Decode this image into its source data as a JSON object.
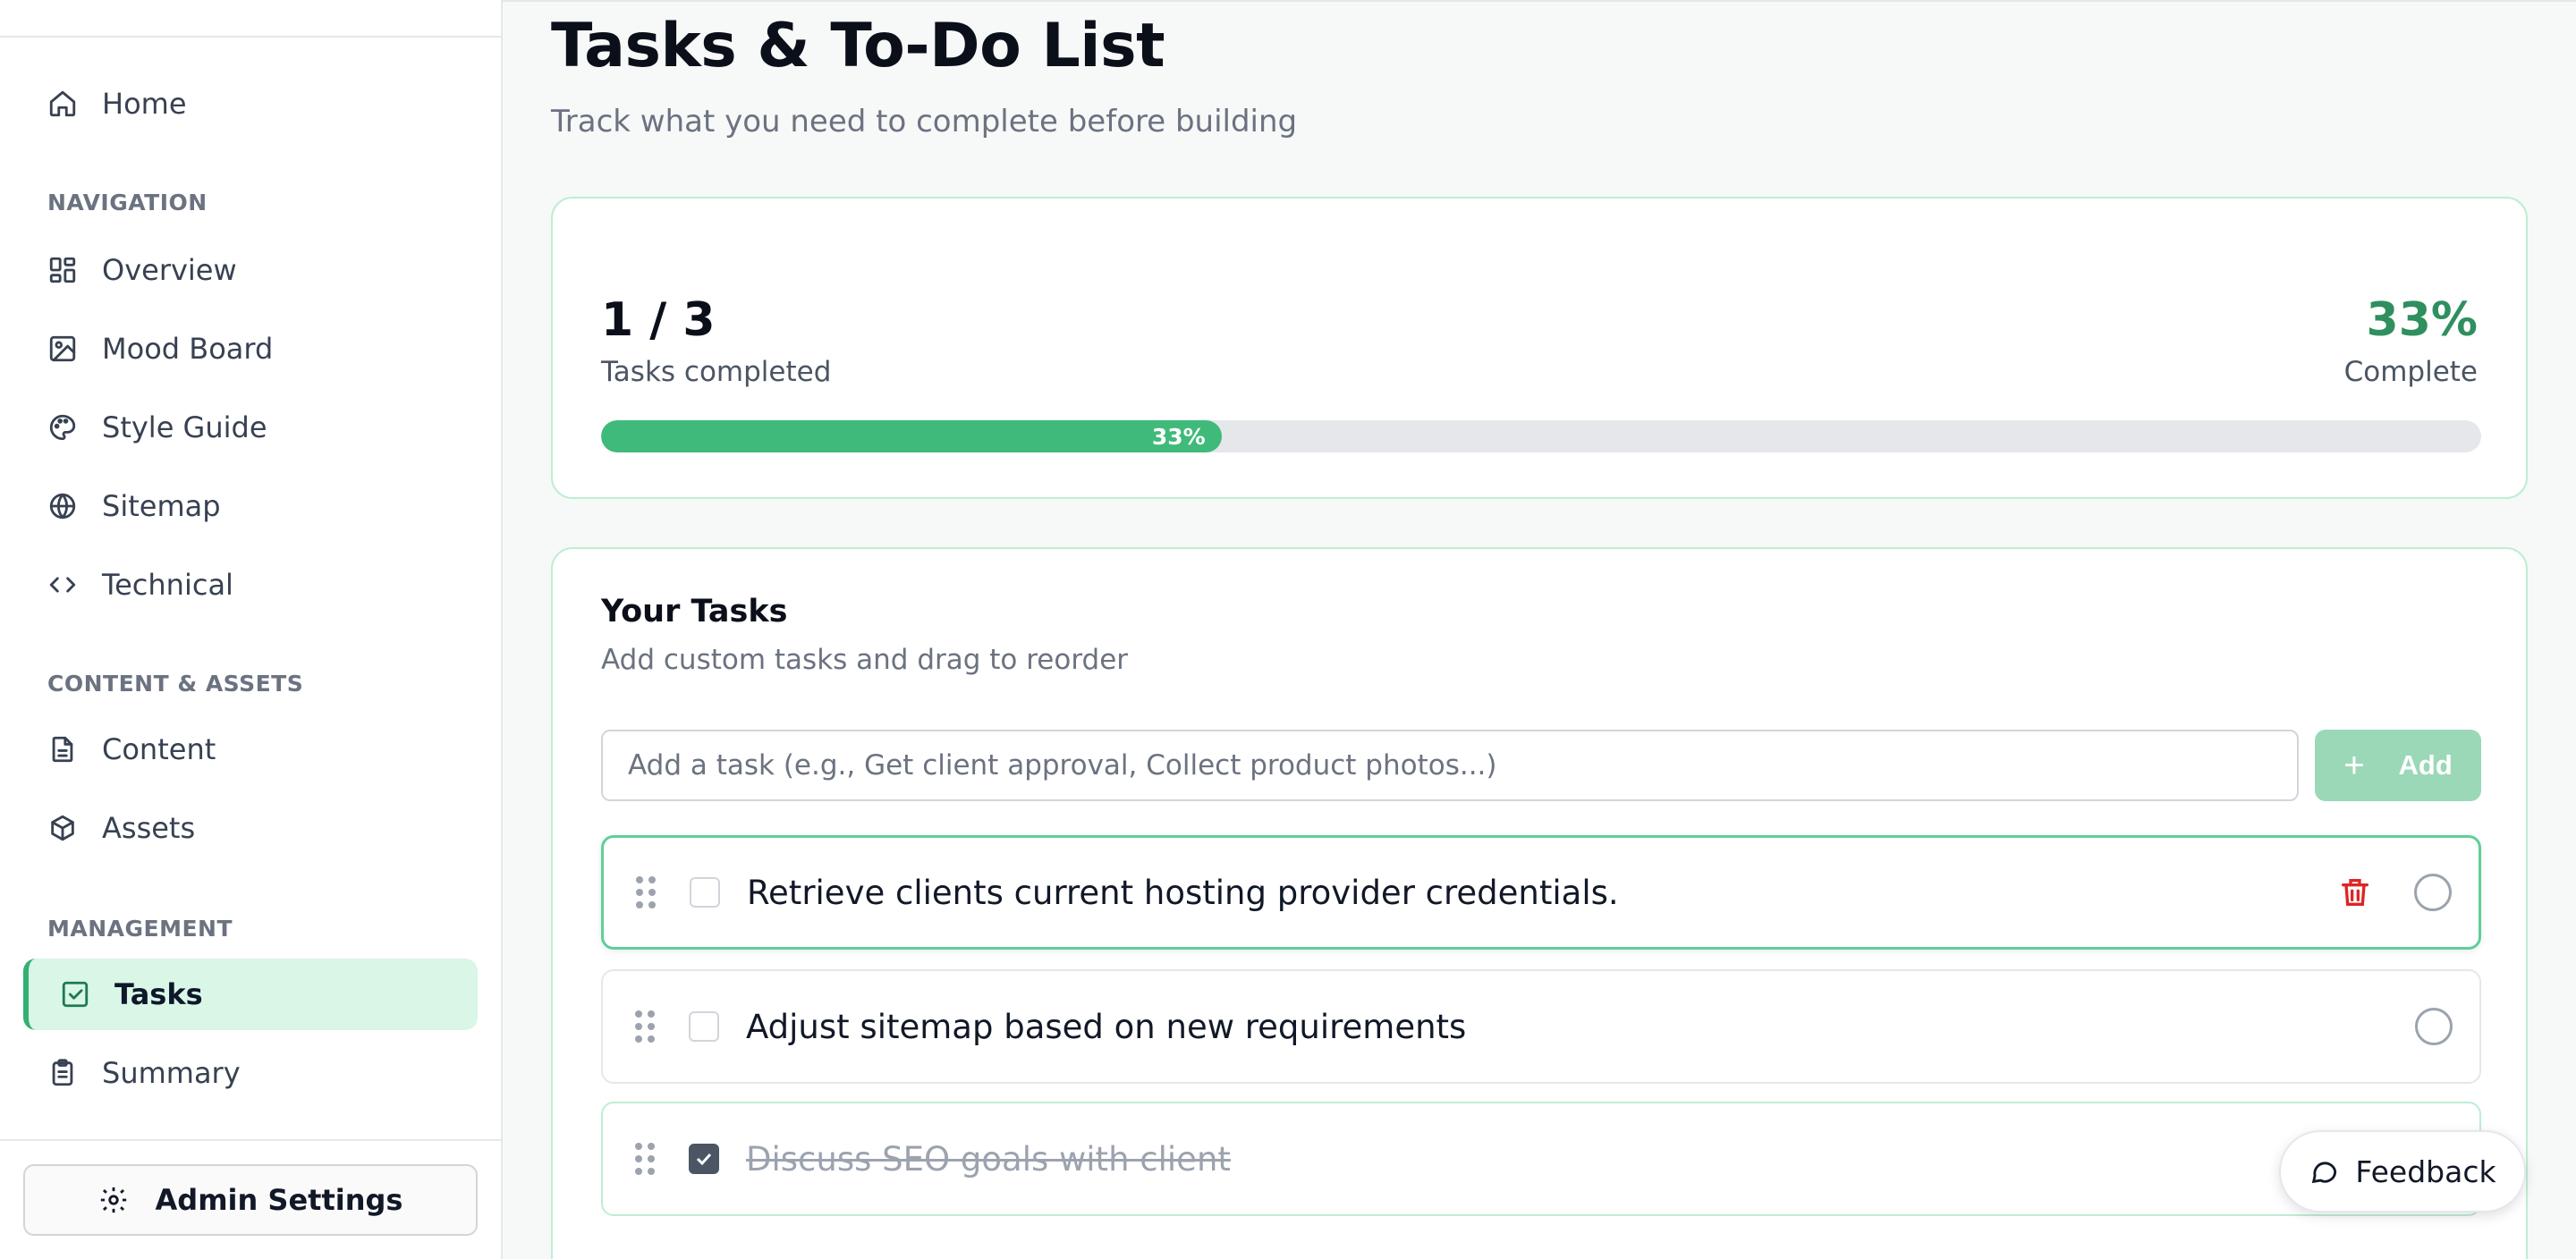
{
  "sidebar": {
    "home": {
      "label": "Home",
      "icon": "home-icon"
    },
    "sections": {
      "navigation": "NAVIGATION",
      "content_assets": "CONTENT & ASSETS",
      "management": "MANAGEMENT"
    },
    "items": [
      {
        "label": "Overview",
        "icon": "grid-icon"
      },
      {
        "label": "Mood Board",
        "icon": "image-icon"
      },
      {
        "label": "Style Guide",
        "icon": "palette-icon"
      },
      {
        "label": "Sitemap",
        "icon": "globe-icon"
      },
      {
        "label": "Technical",
        "icon": "code-icon"
      },
      {
        "label": "Content",
        "icon": "document-icon"
      },
      {
        "label": "Assets",
        "icon": "box-icon"
      },
      {
        "label": "Tasks",
        "icon": "checkbox-icon",
        "active": true
      },
      {
        "label": "Summary",
        "icon": "clipboard-icon"
      }
    ],
    "admin_button": "Admin Settings"
  },
  "header": {
    "title": "Tasks & To-Do List",
    "subtitle": "Track what you need to complete before building"
  },
  "progress": {
    "count": "1 / 3",
    "count_label": "Tasks completed",
    "percent": "33%",
    "percent_label": "Complete",
    "bar_label": "33%",
    "fraction": 0.33
  },
  "tasks": {
    "title": "Your Tasks",
    "subtitle": "Add custom tasks and drag to reorder",
    "input_placeholder": "Add a task (e.g., Get client approval, Collect product photos...)",
    "add_label": "Add",
    "add_icon": "+",
    "items": [
      {
        "text": "Retrieve clients current hosting provider credentials.",
        "done": false,
        "selected": true
      },
      {
        "text": "Adjust sitemap based on new requirements",
        "done": false
      },
      {
        "text": "Discuss SEO goals with client",
        "done": true
      }
    ]
  },
  "feedback": {
    "label": "Feedback"
  },
  "colors": {
    "accent": "#3fba7a",
    "accent_dark": "#2f8f5e",
    "active_nav_bg": "#d9f6e6",
    "danger": "#dc2626"
  }
}
